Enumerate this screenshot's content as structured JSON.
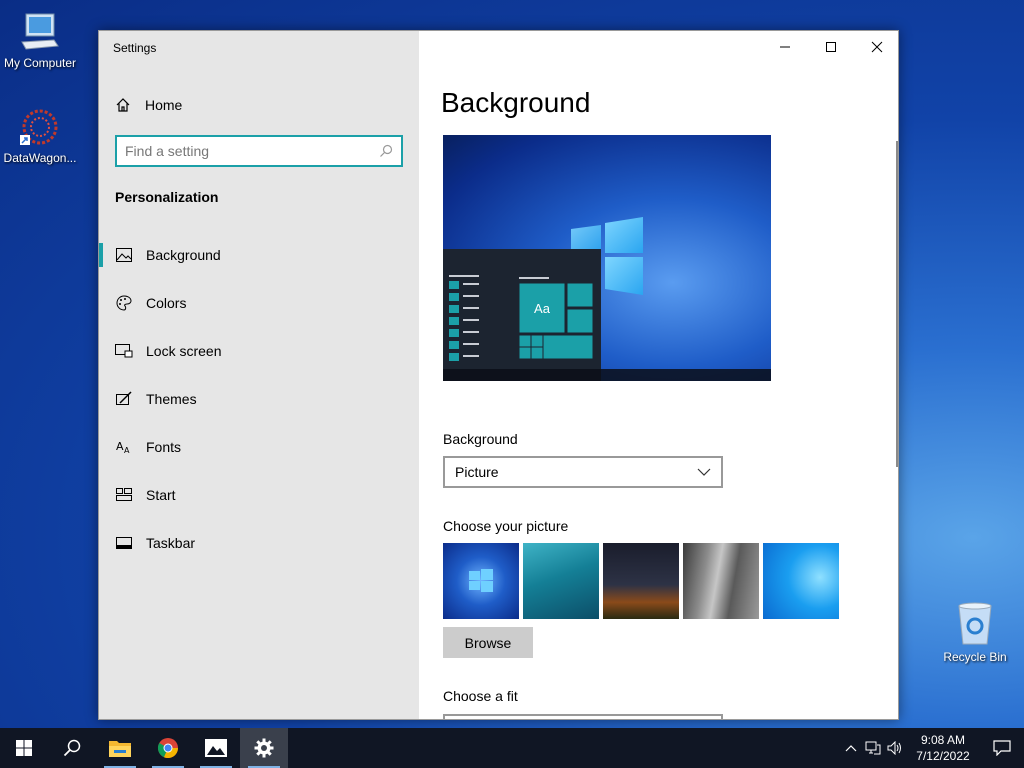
{
  "desktop": {
    "icons": [
      {
        "label": "My Computer"
      },
      {
        "label": "DataWagon..."
      },
      {
        "label": "Recycle Bin"
      }
    ]
  },
  "window": {
    "title": "Settings",
    "controls": {
      "minimize": "minimize-icon",
      "maximize": "maximize-icon",
      "close": "close-icon"
    }
  },
  "sidebar": {
    "home_label": "Home",
    "search_placeholder": "Find a setting",
    "section_title": "Personalization",
    "items": [
      {
        "label": "Background",
        "icon": "picture-icon",
        "active": true
      },
      {
        "label": "Colors",
        "icon": "palette-icon",
        "active": false
      },
      {
        "label": "Lock screen",
        "icon": "lock-screen-icon",
        "active": false
      },
      {
        "label": "Themes",
        "icon": "themes-icon",
        "active": false
      },
      {
        "label": "Fonts",
        "icon": "fonts-icon",
        "active": false
      },
      {
        "label": "Start",
        "icon": "start-icon",
        "active": false
      },
      {
        "label": "Taskbar",
        "icon": "taskbar-icon",
        "active": false
      }
    ]
  },
  "main": {
    "title": "Background",
    "preview_sample_text": "Aa",
    "background_label": "Background",
    "background_value": "Picture",
    "choose_picture_label": "Choose your picture",
    "browse_label": "Browse",
    "choose_fit_label": "Choose a fit"
  },
  "taskbar": {
    "apps": [
      "start-icon",
      "search-icon",
      "file-explorer-icon",
      "chrome-icon",
      "photos-icon",
      "settings-icon"
    ],
    "time": "9:08 AM",
    "date": "7/12/2022"
  },
  "colors": {
    "accent": "#1ba0a8",
    "sidebar_bg": "#e6e6e6",
    "taskbar_bg": "#101624"
  }
}
